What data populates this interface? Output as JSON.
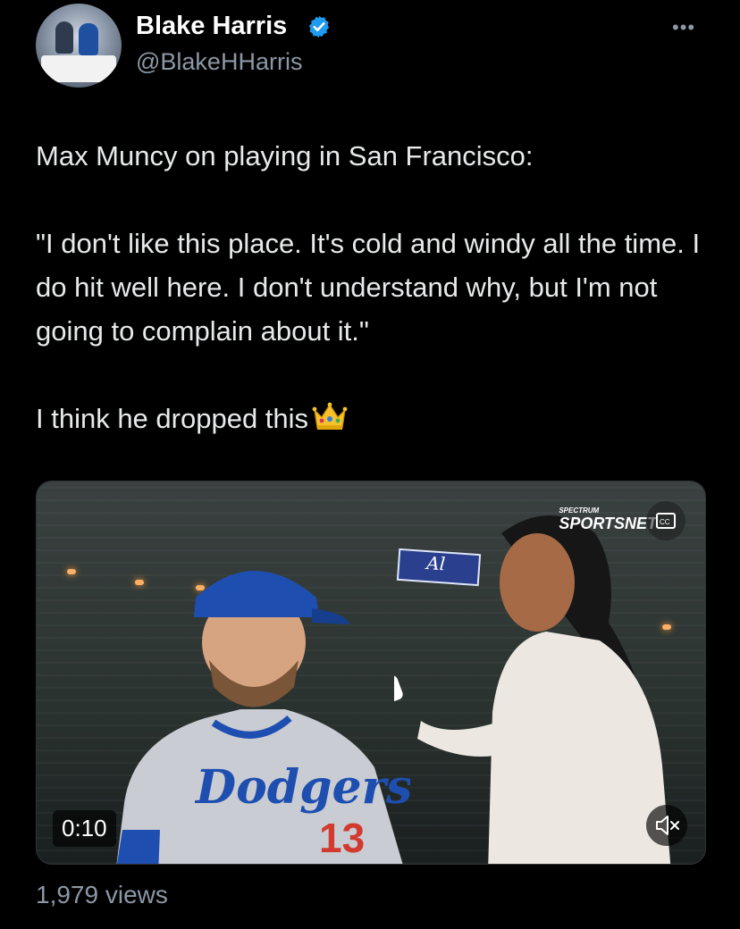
{
  "author": {
    "display_name": "Blake Harris",
    "handle": "@BlakeHHarris",
    "verified": true
  },
  "tweet": {
    "paragraphs": [
      "Max Muncy on playing in San Francisco:",
      "\"I don't like this place. It's cold and windy all the time. I do hit well here. I don't understand why, but I'm not going to complain about it.\"",
      "I think he dropped this"
    ],
    "emoji": "crown-emoji"
  },
  "media": {
    "timecode": "0:10",
    "broadcast_logo_top": "SPECTRUM",
    "broadcast_logo_main": "SPORTSNET",
    "sign_text": "Al",
    "jersey_text": "Dodgers",
    "jersey_number": "13"
  },
  "footer": {
    "views": "1,979 views"
  },
  "colors": {
    "background": "#000000",
    "text": "#e7e9ea",
    "secondary": "#8b98a5",
    "verified": "#1d9bf0"
  }
}
